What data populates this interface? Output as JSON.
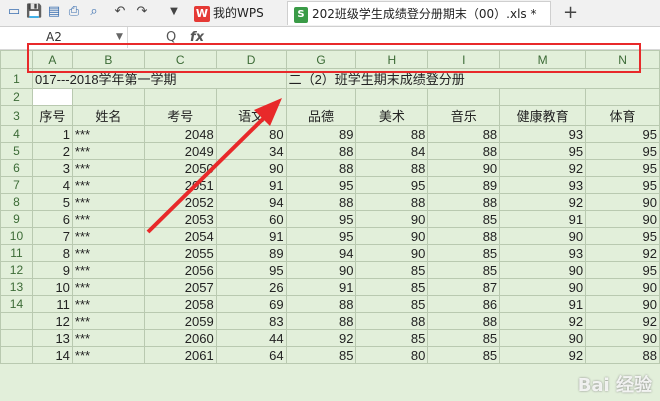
{
  "tabs": {
    "wps_label": "我的WPS",
    "doc_label": "202班级学生成绩登分册期末（00）.xls *",
    "add_label": "+"
  },
  "formula_bar": {
    "cell_ref": "A2",
    "fx_label": "fx",
    "zoom_icon": "Q"
  },
  "columns": [
    "A",
    "B",
    "C",
    "D",
    "G",
    "H",
    "I",
    "M",
    "N"
  ],
  "row_numbers": [
    "1",
    "2",
    "3",
    "4",
    "5",
    "6",
    "7",
    "8",
    "9",
    "10",
    "11",
    "12",
    "13",
    "14"
  ],
  "title_row": {
    "left": "017---2018学年第一学期",
    "right": "二（2）班学生期末成绩登分册"
  },
  "headers": [
    "序号",
    "姓名",
    "考号",
    "语文",
    "品德",
    "美术",
    "音乐",
    "健康教育",
    "体育"
  ],
  "rows": [
    [
      "1",
      "***",
      "2048",
      "80",
      "89",
      "88",
      "88",
      "93",
      "95"
    ],
    [
      "2",
      "***",
      "2049",
      "34",
      "88",
      "84",
      "88",
      "95",
      "95"
    ],
    [
      "3",
      "***",
      "2050",
      "90",
      "88",
      "88",
      "90",
      "92",
      "95"
    ],
    [
      "4",
      "***",
      "2051",
      "91",
      "95",
      "95",
      "89",
      "93",
      "95"
    ],
    [
      "5",
      "***",
      "2052",
      "94",
      "88",
      "88",
      "88",
      "92",
      "90"
    ],
    [
      "6",
      "***",
      "2053",
      "60",
      "95",
      "90",
      "85",
      "91",
      "90"
    ],
    [
      "7",
      "***",
      "2054",
      "91",
      "95",
      "90",
      "88",
      "90",
      "95"
    ],
    [
      "8",
      "***",
      "2055",
      "89",
      "94",
      "90",
      "85",
      "93",
      "92"
    ],
    [
      "9",
      "***",
      "2056",
      "95",
      "90",
      "85",
      "85",
      "90",
      "95"
    ],
    [
      "10",
      "***",
      "2057",
      "26",
      "91",
      "85",
      "87",
      "90",
      "90"
    ],
    [
      "11",
      "***",
      "2058",
      "69",
      "88",
      "85",
      "86",
      "91",
      "90"
    ],
    [
      "12",
      "***",
      "2059",
      "83",
      "88",
      "88",
      "88",
      "92",
      "92"
    ],
    [
      "13",
      "***",
      "2060",
      "44",
      "92",
      "85",
      "85",
      "90",
      "90"
    ],
    [
      "14",
      "***",
      "2061",
      "64",
      "85",
      "80",
      "85",
      "92",
      "88"
    ]
  ],
  "watermark": "Bai 经验",
  "colors": {
    "grid_bg": "#e2efda",
    "highlight_box": "#e8292a",
    "arrow": "#e8292a"
  }
}
